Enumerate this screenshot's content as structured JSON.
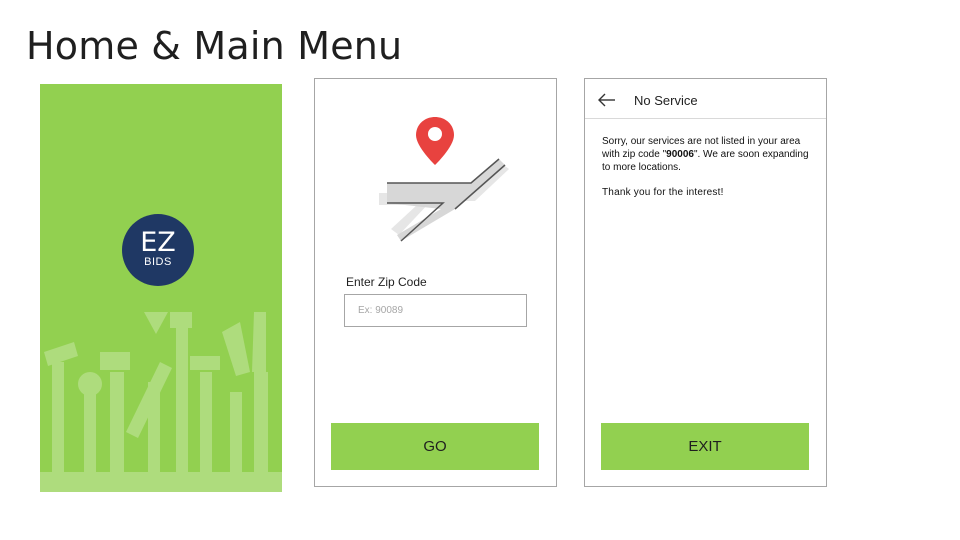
{
  "page": {
    "title": "Home & Main Menu"
  },
  "splash": {
    "background_color": "#92d050",
    "logo": {
      "main": "EZ",
      "sub": "BIDS",
      "color": "#1f3864"
    }
  },
  "zip_screen": {
    "label": "Enter Zip Code",
    "input": {
      "placeholder": "Ex: 90089",
      "value": ""
    },
    "button_label": "GO",
    "map_icon": "map-location-pin-icon"
  },
  "no_service_screen": {
    "back_icon": "arrow-left-icon",
    "title": "No Service",
    "message_before": "Sorry, our services are not listed in your area with zip code \"",
    "zip_code": "90006",
    "message_after": "\". We are soon expanding to more locations.",
    "thanks": "Thank you for the interest!",
    "button_label": "EXIT"
  },
  "colors": {
    "accent": "#92d050",
    "pin": "#e8423f",
    "logo": "#1f3864",
    "border": "#a6a6a6"
  }
}
